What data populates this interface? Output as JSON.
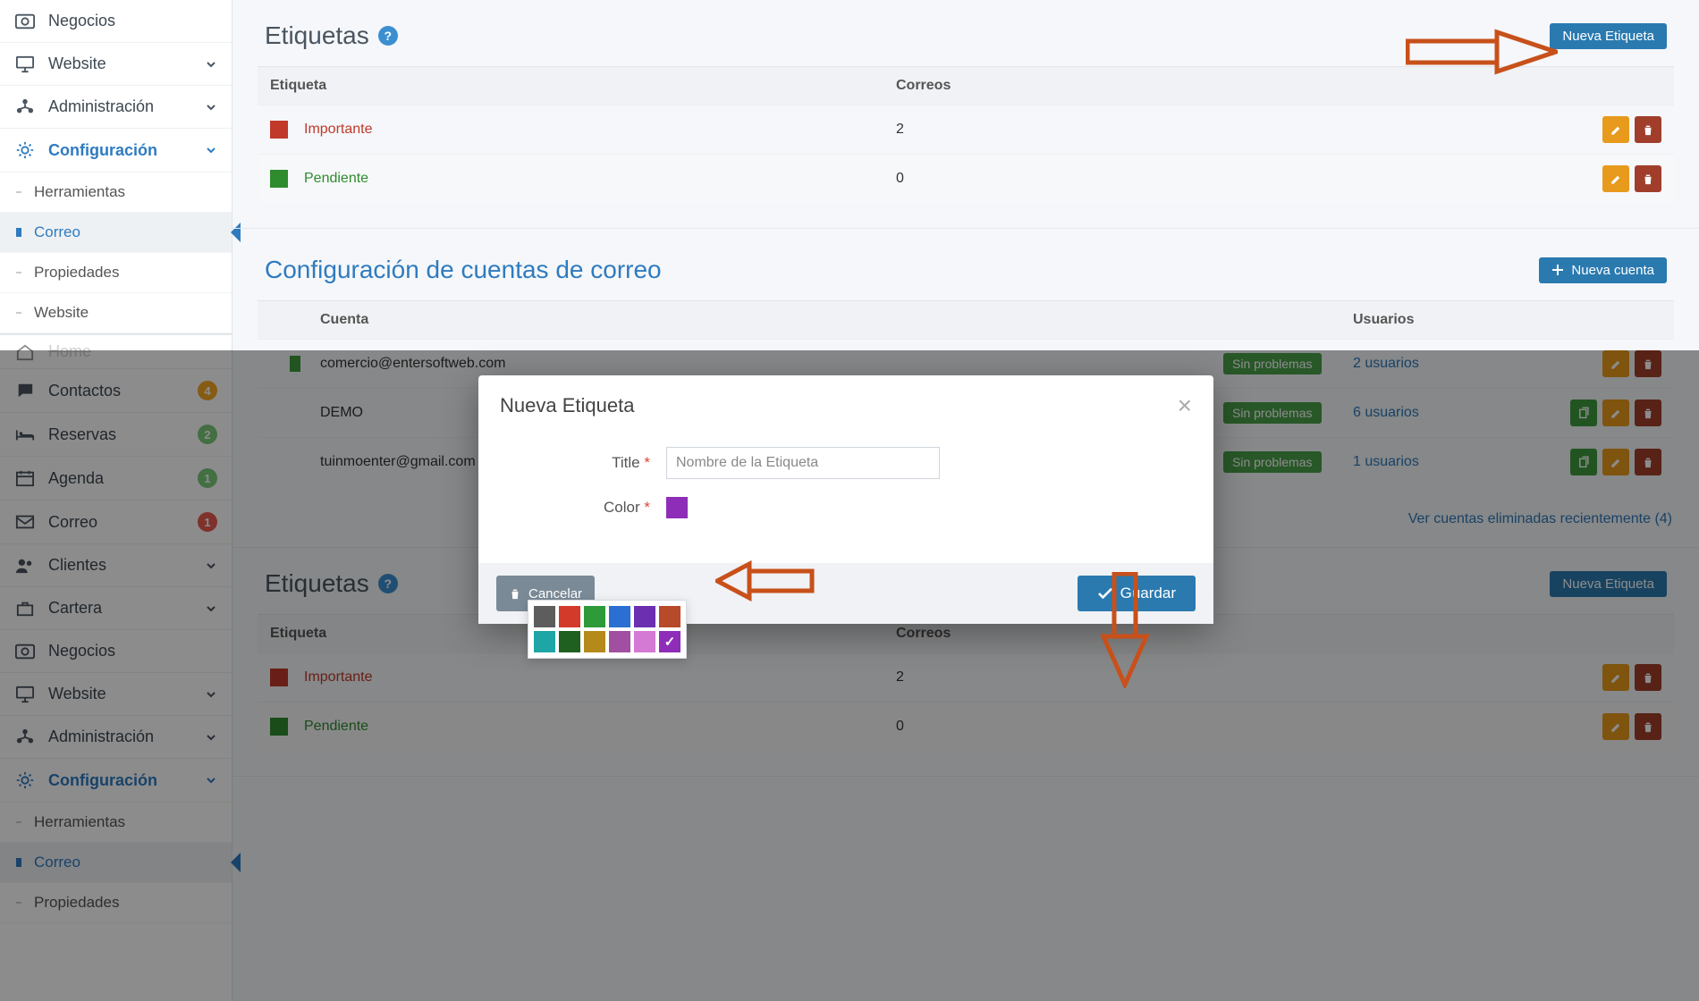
{
  "sidebar": {
    "items": [
      {
        "icon": "money-icon",
        "label": "Negocios",
        "chev": false
      },
      {
        "icon": "monitor-icon",
        "label": "Website",
        "chev": true
      },
      {
        "icon": "org-icon",
        "label": "Administración",
        "chev": true
      },
      {
        "icon": "gear-icon",
        "label": "Configuración",
        "chev": true,
        "active": true
      }
    ],
    "config_sub": [
      {
        "label": "Herramientas"
      },
      {
        "label": "Correo",
        "selected": true
      },
      {
        "label": "Propiedades"
      },
      {
        "label": "Website"
      }
    ],
    "second_group": [
      {
        "icon": "chat-icon",
        "label": "Contactos",
        "badge": "4",
        "badgeCls": "orange"
      },
      {
        "icon": "bed-icon",
        "label": "Reservas",
        "badge": "2",
        "badgeCls": "green"
      },
      {
        "icon": "calendar-icon",
        "label": "Agenda",
        "badge": "1",
        "badgeCls": "green"
      },
      {
        "icon": "mail-icon",
        "label": "Correo",
        "badge": "1",
        "badgeCls": "red"
      },
      {
        "icon": "users-icon",
        "label": "Clientes",
        "chev": true
      },
      {
        "icon": "briefcase-icon",
        "label": "Cartera",
        "chev": true
      },
      {
        "icon": "money-icon",
        "label": "Negocios"
      },
      {
        "icon": "monitor-icon",
        "label": "Website",
        "chev": true
      },
      {
        "icon": "org-icon",
        "label": "Administración",
        "chev": true
      },
      {
        "icon": "gear-icon",
        "label": "Configuración",
        "chev": true,
        "active": true
      }
    ],
    "second_sub": [
      {
        "label": "Herramientas"
      },
      {
        "label": "Correo",
        "selected": true
      },
      {
        "label": "Propiedades"
      }
    ],
    "truncated_home": "Home"
  },
  "tags_panel": {
    "title": "Etiquetas",
    "new_button": "Nueva Etiqueta",
    "header_tag": "Etiqueta",
    "header_mail": "Correos",
    "rows": [
      {
        "name": "Importante",
        "count": "2",
        "color": "#c0392b",
        "nameCls": "linkred"
      },
      {
        "name": "Pendiente",
        "count": "0",
        "color": "#2e8b2e",
        "nameCls": "linkgreen"
      }
    ]
  },
  "accounts_panel": {
    "title": "Configuración de cuentas de correo",
    "new_button": "Nueva cuenta",
    "header_account": "Cuenta",
    "header_users": "Usuarios",
    "status_ok": "Sin problemas",
    "rows": [
      {
        "email": "comercio@entersoftweb.com",
        "users": "2 usuarios",
        "hasDup": false
      },
      {
        "email": "DEMO",
        "users": "6 usuarios",
        "hasDup": true
      },
      {
        "email": "tuinmoenter@gmail.com",
        "users": "1 usuarios",
        "hasDup": true
      }
    ],
    "deleted_link": "Ver cuentas eliminadas recientemente (4)"
  },
  "modal": {
    "title": "Nueva Etiqueta",
    "field_title": "Title",
    "field_title_placeholder": "Nombre de la Etiqueta",
    "field_color": "Color",
    "cancel": "Cancelar",
    "save": "Guardar",
    "palette": [
      [
        "#5d5d5d",
        "#d43a2a",
        "#2f9a3a",
        "#2a6fd1",
        "#6b2fb0",
        "#b74a2a"
      ],
      [
        "#1ea5a5",
        "#1f5f1f",
        "#b58a1a",
        "#a14fa1",
        "#d47ad4",
        "#8e2db7"
      ]
    ],
    "selected_color": "#8e2db7"
  }
}
